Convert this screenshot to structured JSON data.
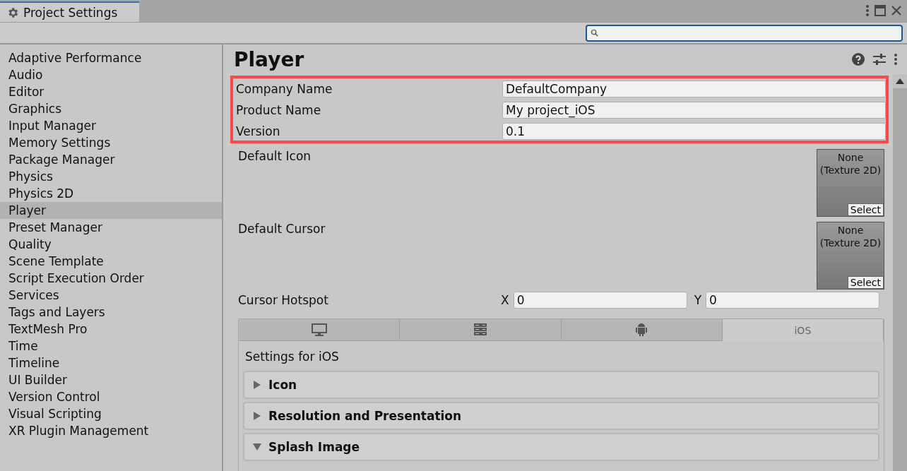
{
  "window": {
    "title": "Project Settings"
  },
  "sidebar": {
    "items": [
      {
        "label": "Adaptive Performance",
        "selected": false
      },
      {
        "label": "Audio",
        "selected": false
      },
      {
        "label": "Editor",
        "selected": false
      },
      {
        "label": "Graphics",
        "selected": false
      },
      {
        "label": "Input Manager",
        "selected": false
      },
      {
        "label": "Memory Settings",
        "selected": false
      },
      {
        "label": "Package Manager",
        "selected": false
      },
      {
        "label": "Physics",
        "selected": false
      },
      {
        "label": "Physics 2D",
        "selected": false
      },
      {
        "label": "Player",
        "selected": true
      },
      {
        "label": "Preset Manager",
        "selected": false
      },
      {
        "label": "Quality",
        "selected": false
      },
      {
        "label": "Scene Template",
        "selected": false
      },
      {
        "label": "Script Execution Order",
        "selected": false
      },
      {
        "label": "Services",
        "selected": false
      },
      {
        "label": "Tags and Layers",
        "selected": false
      },
      {
        "label": "TextMesh Pro",
        "selected": false
      },
      {
        "label": "Time",
        "selected": false
      },
      {
        "label": "Timeline",
        "selected": false
      },
      {
        "label": "UI Builder",
        "selected": false
      },
      {
        "label": "Version Control",
        "selected": false
      },
      {
        "label": "Visual Scripting",
        "selected": false
      },
      {
        "label": "XR Plugin Management",
        "selected": false
      }
    ]
  },
  "panel": {
    "title": "Player",
    "identity": {
      "highlighted": true,
      "fields": [
        {
          "label": "Company Name",
          "value": "DefaultCompany"
        },
        {
          "label": "Product Name",
          "value": "My project_iOS"
        },
        {
          "label": "Version",
          "value": "0.1"
        }
      ]
    },
    "textures": [
      {
        "label": "Default Icon",
        "value": "None\n(Texture 2D)",
        "button": "Select"
      },
      {
        "label": "Default Cursor",
        "value": "None\n(Texture 2D)",
        "button": "Select"
      }
    ],
    "hotspot": {
      "label": "Cursor Hotspot",
      "x_label": "X",
      "x_value": "0",
      "y_label": "Y",
      "y_value": "0"
    },
    "platform_tabs": [
      {
        "kind": "desktop",
        "selected": false
      },
      {
        "kind": "server",
        "selected": false
      },
      {
        "kind": "android",
        "selected": false
      },
      {
        "kind": "text",
        "label": "iOS",
        "selected": true
      }
    ],
    "platform_heading": "Settings for iOS",
    "sections": [
      {
        "label": "Icon",
        "expanded": false
      },
      {
        "label": "Resolution and Presentation",
        "expanded": false
      },
      {
        "label": "Splash Image",
        "expanded": true
      }
    ]
  }
}
